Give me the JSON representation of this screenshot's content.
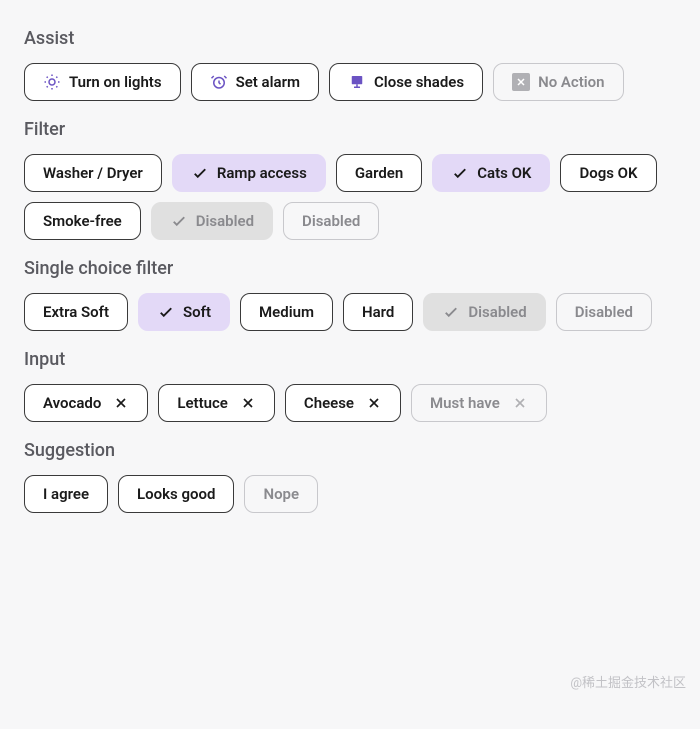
{
  "assist": {
    "title": "Assist",
    "items": [
      {
        "label": "Turn on lights",
        "icon": "sun"
      },
      {
        "label": "Set alarm",
        "icon": "alarm"
      },
      {
        "label": "Close shades",
        "icon": "shades"
      },
      {
        "label": "No Action",
        "icon": "box-x",
        "disabled": true
      }
    ]
  },
  "filter": {
    "title": "Filter",
    "items": [
      {
        "label": "Washer / Dryer"
      },
      {
        "label": "Ramp access",
        "selected": true
      },
      {
        "label": "Garden"
      },
      {
        "label": "Cats OK",
        "selected": true
      },
      {
        "label": "Dogs OK"
      },
      {
        "label": "Smoke-free"
      },
      {
        "label": "Disabled",
        "disabledFilled": true,
        "check": true
      },
      {
        "label": "Disabled",
        "disabledOutline": true
      }
    ]
  },
  "singleChoice": {
    "title": "Single choice filter",
    "items": [
      {
        "label": "Extra Soft"
      },
      {
        "label": "Soft",
        "selected": true
      },
      {
        "label": "Medium"
      },
      {
        "label": "Hard"
      },
      {
        "label": "Disabled",
        "disabledFilled": true,
        "check": true
      },
      {
        "label": "Disabled",
        "disabledOutline": true
      }
    ]
  },
  "input": {
    "title": "Input",
    "items": [
      {
        "label": "Avocado"
      },
      {
        "label": "Lettuce"
      },
      {
        "label": "Cheese"
      },
      {
        "label": "Must have",
        "disabledOutline": true
      }
    ]
  },
  "suggestion": {
    "title": "Suggestion",
    "items": [
      {
        "label": "I agree"
      },
      {
        "label": "Looks good"
      },
      {
        "label": "Nope",
        "disabledOutline": true
      }
    ]
  },
  "watermark": "@稀土掘金技术社区",
  "colors": {
    "accent": "#6b53c3",
    "selectedBg": "#e3d9f7"
  }
}
